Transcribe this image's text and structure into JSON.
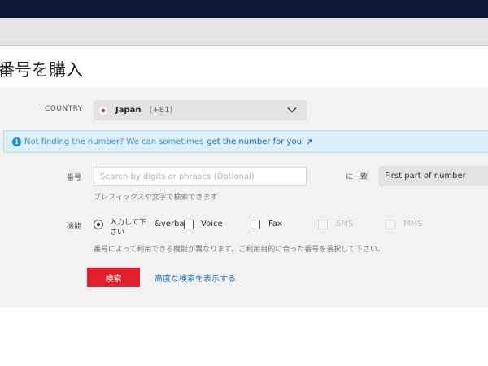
{
  "page": {
    "title": "番号を購入"
  },
  "country": {
    "label": "COUNTRY",
    "name": "Japan",
    "code": "(+81)"
  },
  "info": {
    "text": "Not finding the number? We can sometimes",
    "link": "get the number for you"
  },
  "number_search": {
    "label": "番号",
    "placeholder": "Search by digits or phrases (Optional)",
    "value": "",
    "match_label": "に一致",
    "match_selected": "First part of number",
    "hint": "プレフィックスや文字で検索できます"
  },
  "features": {
    "label": "機能",
    "radio_label": "入力して下さい",
    "verbal_text": "&verba",
    "voice": "Voice",
    "fax": "Fax",
    "sms": "SMS",
    "mms": "MMS",
    "hint": "番号によって利用できる機能が異なります。ご利用目的に合った番号を選択して下さい。"
  },
  "actions": {
    "search_button": "検索",
    "advanced_link": "高度な検索を表示する"
  },
  "colors": {
    "topbar": "#0f1733",
    "button": "#e21f2f",
    "link": "#1a6fb3",
    "info_bg": "#dceff8"
  },
  "icons": {
    "flag": "japan-flag-icon",
    "chevron": "chevron-down-icon",
    "info": "info-icon",
    "external": "external-link-icon"
  }
}
